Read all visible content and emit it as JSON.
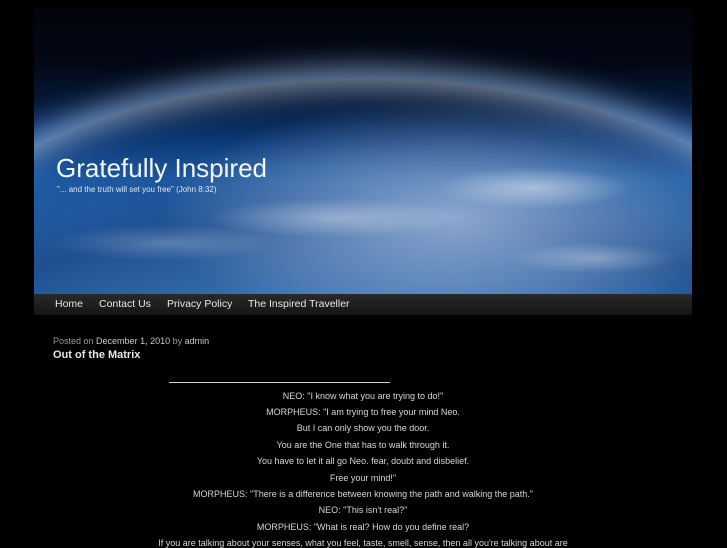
{
  "header": {
    "site_title": "Gratefully Inspired",
    "tagline": "\"... and the truth will set you free\" (John 8:32)"
  },
  "nav": {
    "items": [
      {
        "label": "Home"
      },
      {
        "label": "Contact Us"
      },
      {
        "label": "Privacy Policy"
      },
      {
        "label": "The Inspired Traveller"
      }
    ]
  },
  "post": {
    "posted_on": "Posted on",
    "date": "December 1, 2010",
    "by": "by",
    "author": "admin",
    "title": "Out of the Matrix",
    "lines": [
      "NEO: \"I know what you are trying to do!\"",
      "MORPHEUS: \"I am trying to free your mind Neo.",
      "But I can only show you the door.",
      "You are the One that has to walk through it.",
      "You have to let it all go Neo. fear, doubt and disbelief.",
      "Free your mind!\"",
      "MORPHEUS: \"There is a difference between knowing the path and walking the path.\"",
      "NEO: \"This isn't real?\"",
      "MORPHEUS: \"What is real? How do you define real?",
      "If you are talking about your senses, what you feel, taste, smell, sense, then all you're talking about are"
    ]
  }
}
